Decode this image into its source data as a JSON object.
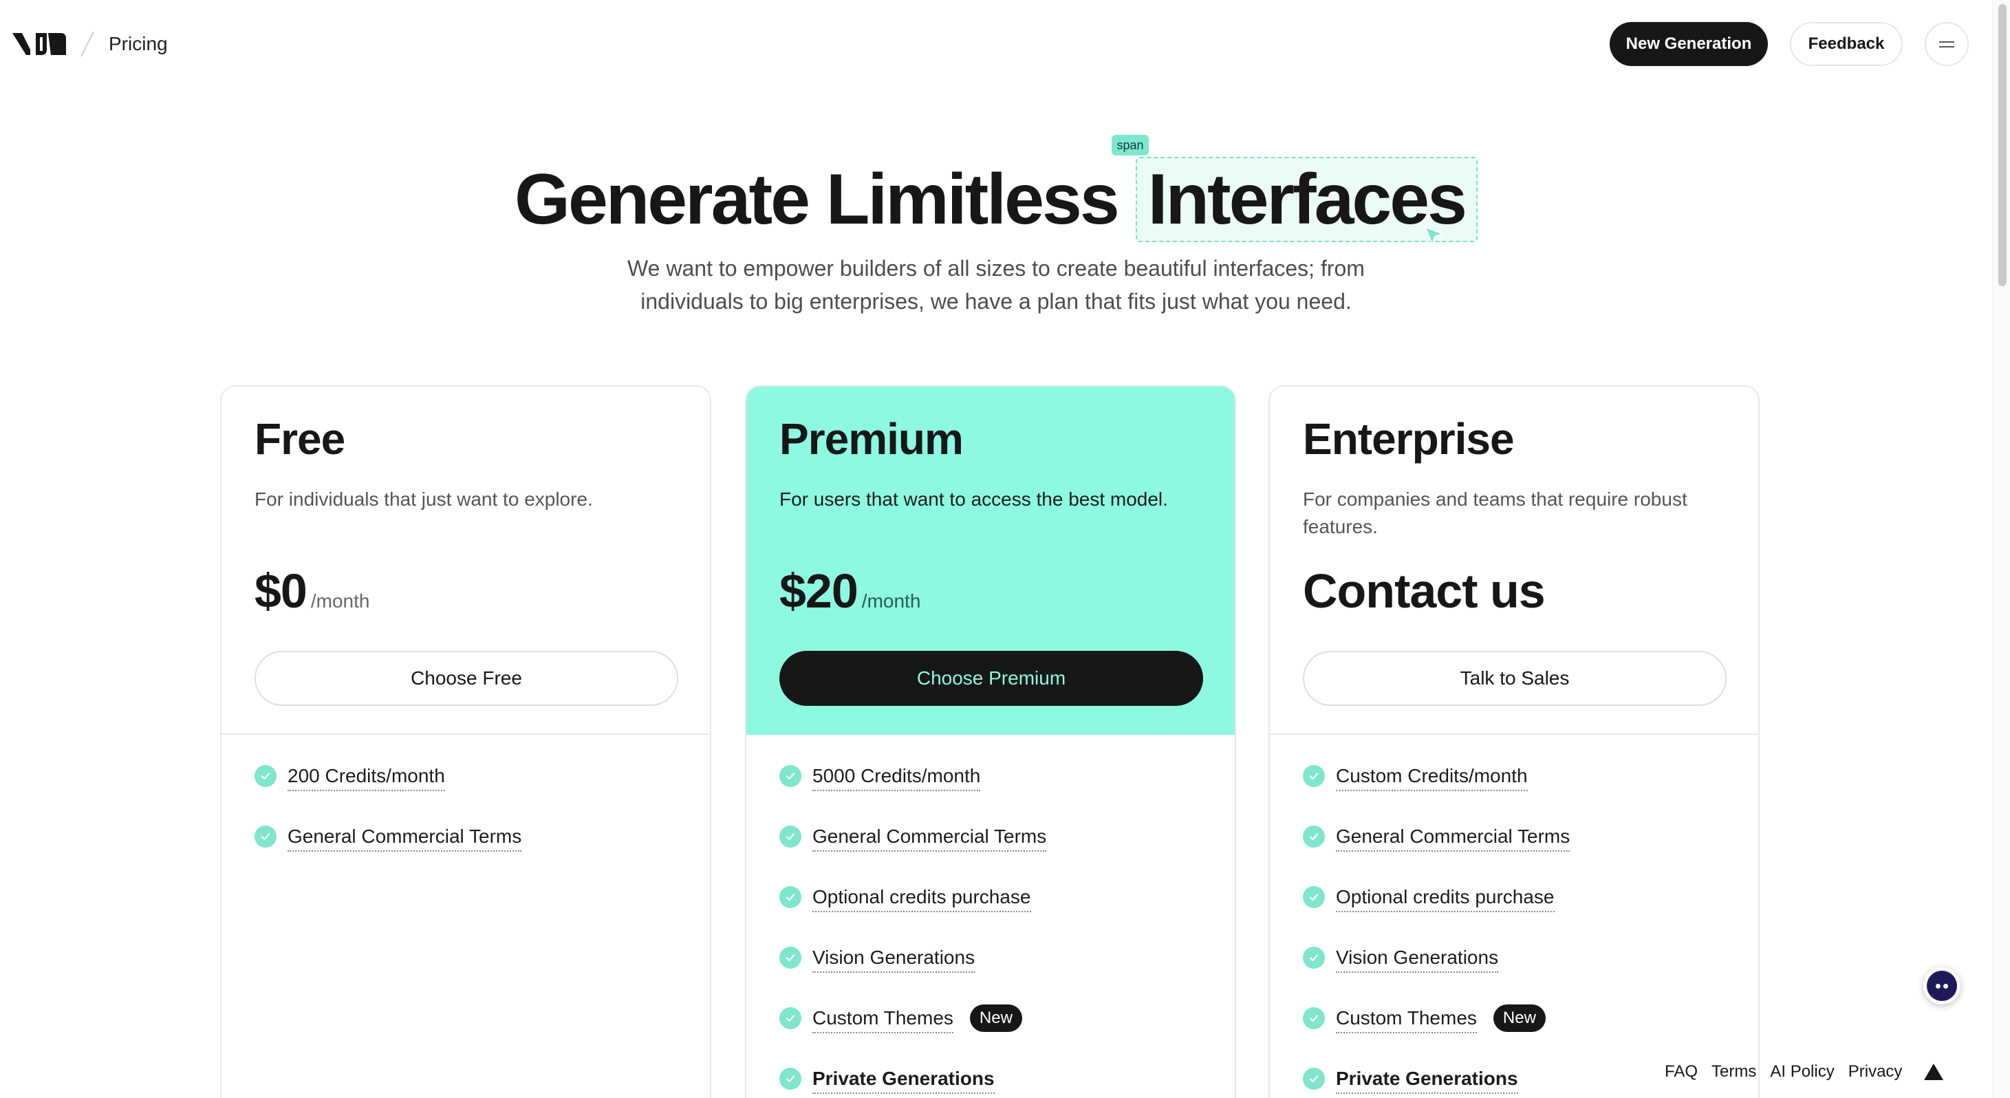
{
  "header": {
    "logo_alt": "v0",
    "breadcrumb": "Pricing",
    "new_generation_label": "New Generation",
    "feedback_label": "Feedback"
  },
  "hero": {
    "title_plain": "Generate Limitless",
    "title_highlight": "Interfaces",
    "highlight_tag": "span",
    "subtitle": "We want to empower builders of all sizes to create beautiful interfaces; from individuals to big enterprises, we have a plan that fits just what you need."
  },
  "plans": [
    {
      "name": "Free",
      "description": "For individuals that just want to explore.",
      "price": "$0",
      "period": "/month",
      "cta": "Choose Free",
      "features": [
        {
          "label": "200 Credits/month"
        },
        {
          "label": "General Commercial Terms"
        }
      ]
    },
    {
      "name": "Premium",
      "description": "For users that want to access the best model.",
      "price": "$20",
      "period": "/month",
      "cta": "Choose Premium",
      "features": [
        {
          "label": "5000 Credits/month"
        },
        {
          "label": "General Commercial Terms"
        },
        {
          "label": "Optional credits purchase"
        },
        {
          "label": "Vision Generations"
        },
        {
          "label": "Custom Themes",
          "badge": "New"
        },
        {
          "label": "Private Generations"
        }
      ]
    },
    {
      "name": "Enterprise",
      "description": "For companies and teams that require robust features.",
      "price": "Contact us",
      "cta": "Talk to Sales",
      "features": [
        {
          "label": "Custom Credits/month"
        },
        {
          "label": "General Commercial Terms"
        },
        {
          "label": "Optional credits purchase"
        },
        {
          "label": "Vision Generations"
        },
        {
          "label": "Custom Themes",
          "badge": "New"
        },
        {
          "label": "Private Generations"
        }
      ]
    }
  ],
  "footer": {
    "links": [
      "FAQ",
      "Terms",
      "AI Policy",
      "Privacy"
    ]
  },
  "colors": {
    "accent": "#8cf9e0",
    "check": "#7fe6cb",
    "dark": "#171717"
  }
}
